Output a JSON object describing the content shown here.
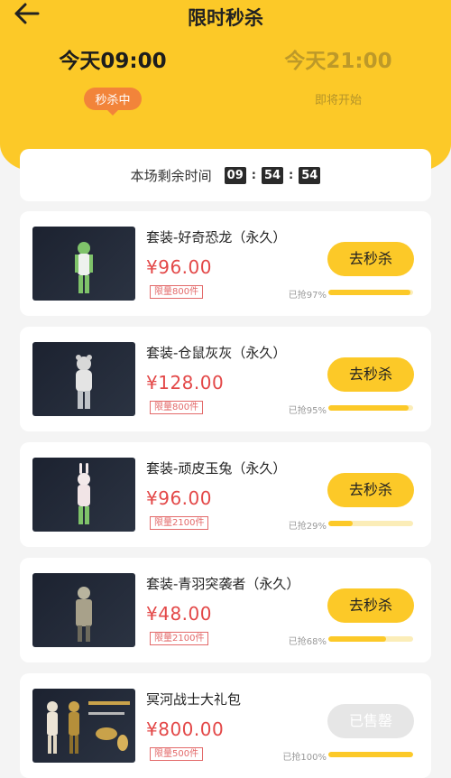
{
  "header": {
    "title": "限时秒杀",
    "back_icon": "back-arrow-icon",
    "slots": [
      {
        "time": "今天09:00",
        "status": "秒杀中"
      },
      {
        "time": "今天21:00",
        "status": "即将开始"
      }
    ]
  },
  "countdown": {
    "label": "本场剩余时间",
    "hh": "09",
    "mm": "54",
    "ss": "54"
  },
  "colors": {
    "accent": "#fcc928",
    "price": "#e34848",
    "status_pill": "#f2843a"
  },
  "products": [
    {
      "name": "套装-好奇恐龙（永久）",
      "price": "¥96.00",
      "limit": "限量800件",
      "sold": "已抢97%",
      "progress": 0.97,
      "button": "去秒杀",
      "soldout": false,
      "figure": "dino"
    },
    {
      "name": "套装-仓鼠灰灰（永久）",
      "price": "¥128.00",
      "limit": "限量800件",
      "sold": "已抢95%",
      "progress": 0.95,
      "button": "去秒杀",
      "soldout": false,
      "figure": "hamster"
    },
    {
      "name": "套装-顽皮玉兔（永久）",
      "price": "¥96.00",
      "limit": "限量2100件",
      "sold": "已抢29%",
      "progress": 0.29,
      "button": "去秒杀",
      "soldout": false,
      "figure": "rabbit"
    },
    {
      "name": "套装-青羽突袭者（永久）",
      "price": "¥48.00",
      "limit": "限量2100件",
      "sold": "已抢68%",
      "progress": 0.68,
      "button": "去秒杀",
      "soldout": false,
      "figure": "raider"
    },
    {
      "name": "冥河战士大礼包",
      "price": "¥800.00",
      "limit": "限量500件",
      "sold": "已抢100%",
      "progress": 1.0,
      "button": "已售罄",
      "soldout": true,
      "figure": "bundle"
    }
  ]
}
